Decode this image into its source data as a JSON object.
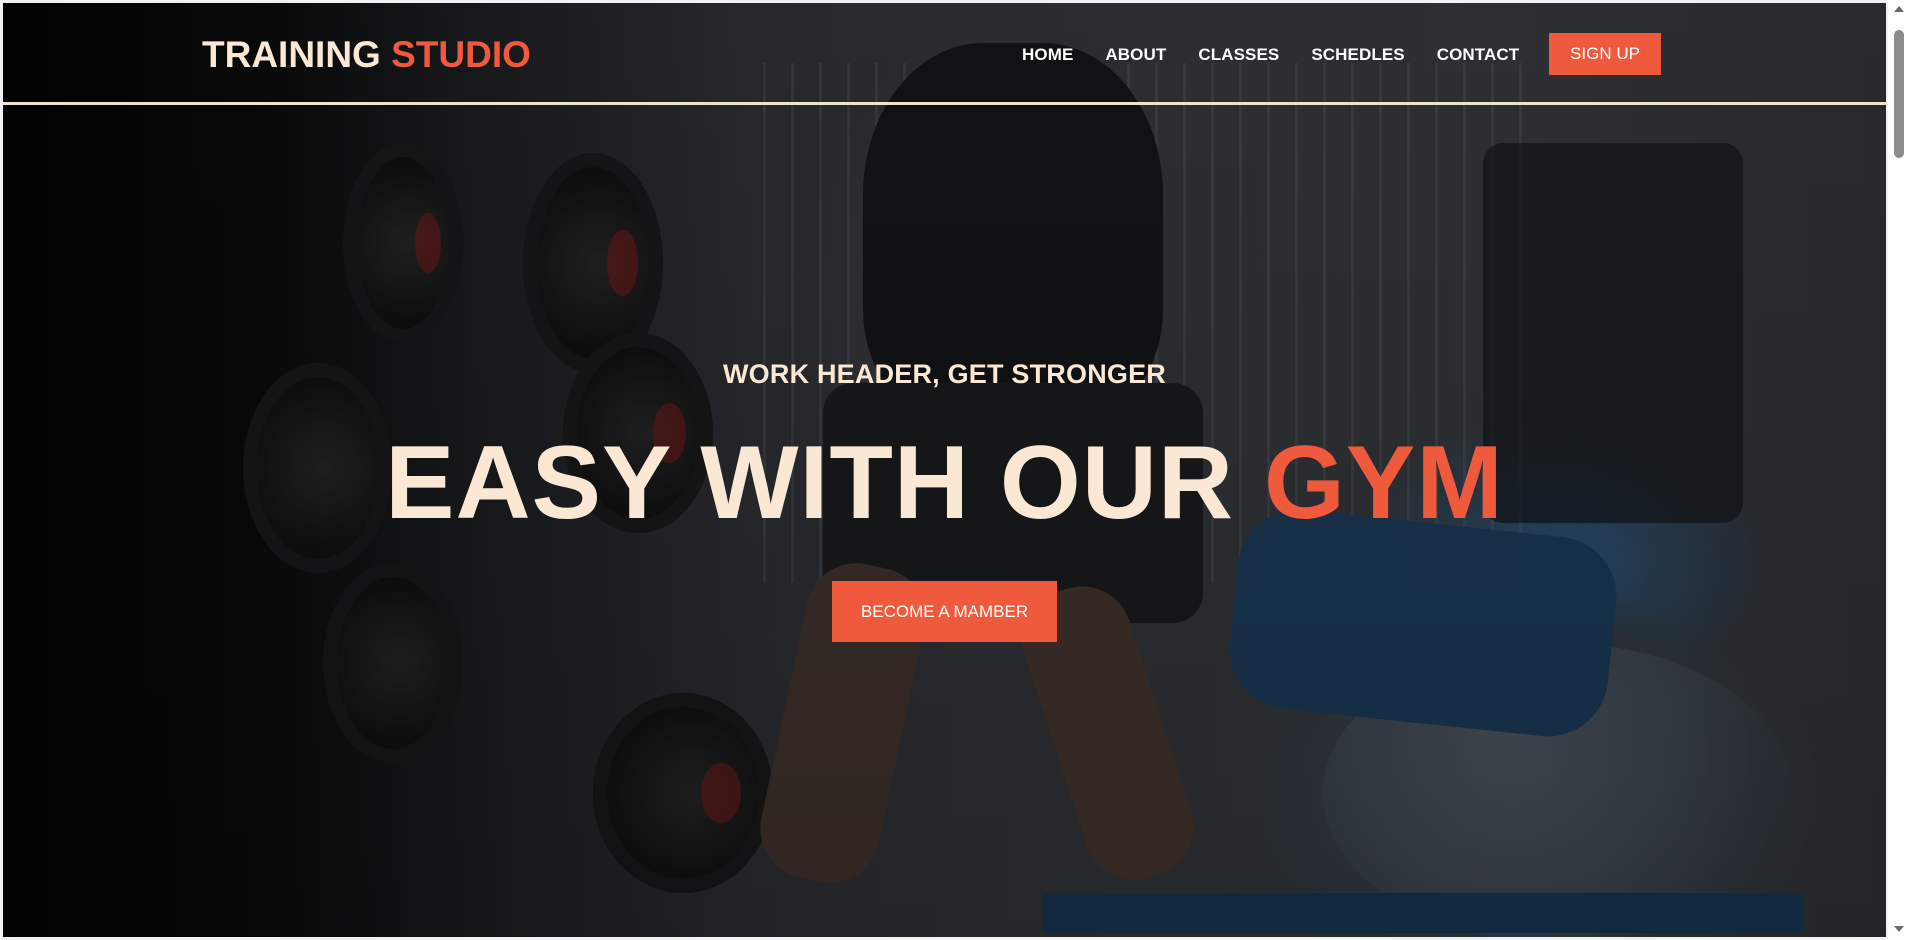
{
  "logo": {
    "primary": "TRAINING",
    "accent": "STUDIO"
  },
  "nav": {
    "items": [
      {
        "label": "HOME"
      },
      {
        "label": "ABOUT"
      },
      {
        "label": "CLASSES"
      },
      {
        "label": "SCHEDLES"
      },
      {
        "label": "CONTACT"
      }
    ],
    "signup_label": "SIGN UP"
  },
  "hero": {
    "subtitle": "WORK HEADER, GET STRONGER",
    "title_main": "EASY WITH OUR",
    "title_accent": "GYM",
    "cta_label": "BECOME A MAMBER"
  },
  "colors": {
    "accent": "#ef5a3c",
    "cream": "#fbe8d4",
    "nav_text": "#ffffff"
  }
}
